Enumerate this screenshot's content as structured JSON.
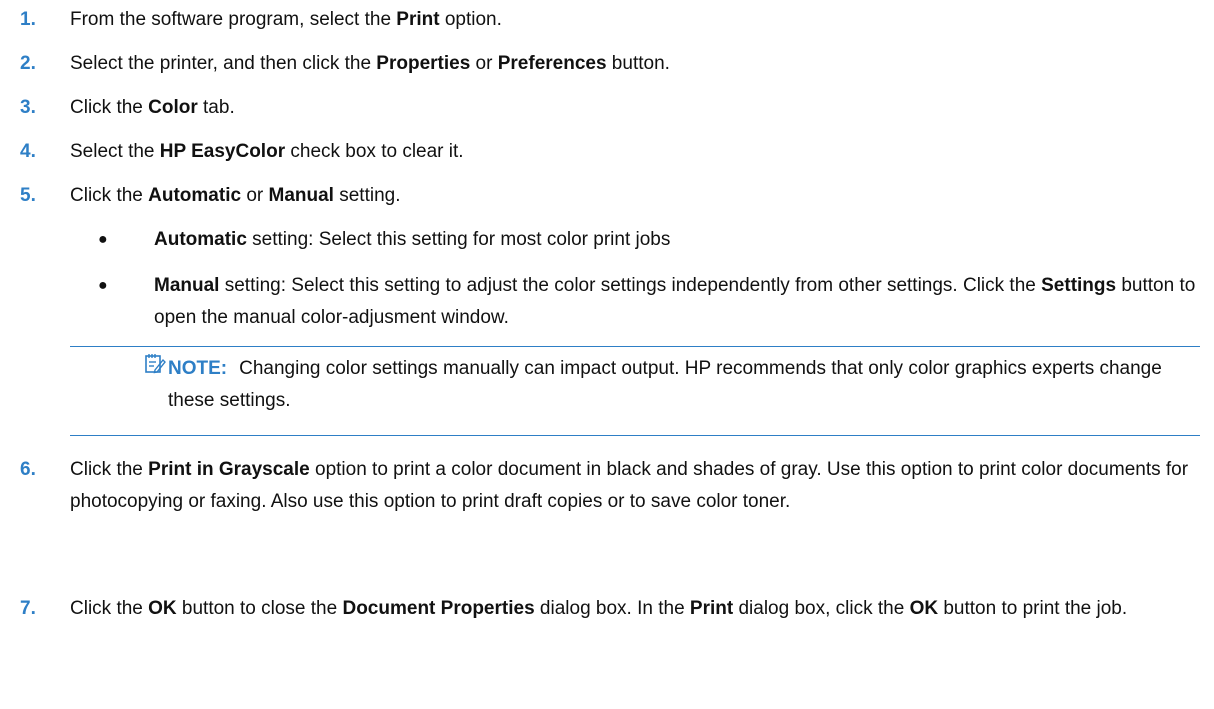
{
  "steps": [
    {
      "num": "1.",
      "parts": [
        "From the software program, select the ",
        "Print",
        " option."
      ]
    },
    {
      "num": "2.",
      "parts": [
        "Select the printer, and then click the ",
        "Properties",
        " or ",
        "Preferences",
        " button."
      ]
    },
    {
      "num": "3.",
      "parts": [
        "Click the ",
        "Color",
        " tab."
      ]
    },
    {
      "num": "4.",
      "parts": [
        "Select the ",
        "HP EasyColor",
        " check box to clear it."
      ]
    },
    {
      "num": "5.",
      "parts": [
        "Click the ",
        "Automatic",
        " or ",
        "Manual",
        " setting."
      ]
    },
    {
      "num": "6.",
      "parts": [
        "Click the ",
        "Print in Grayscale",
        " option to print a color document in black and shades of gray. Use this option to print color documents for photocopying or faxing. Also use this option to print draft copies or to save color toner."
      ]
    },
    {
      "num": "7.",
      "parts": [
        "Click the ",
        "OK",
        " button to close the ",
        "Document Properties",
        " dialog box. In the ",
        "Print",
        " dialog box, click the ",
        "OK",
        " button to print the job."
      ]
    }
  ],
  "bullets": [
    {
      "marker": "●",
      "parts": [
        "Automatic",
        " setting: Select this setting for most color print jobs"
      ]
    },
    {
      "marker": "●",
      "parts": [
        "Manual",
        " setting: Select this setting to adjust the color settings independently from other settings. Click the ",
        "Settings",
        " button to open the manual color-adjusment window."
      ]
    }
  ],
  "note": {
    "icon": "note-icon",
    "label": "NOTE:",
    "text": "Changing color settings manually can impact output. HP recommends that only color graphics experts change these settings."
  },
  "colors": {
    "accent": "#2e7fc6",
    "text": "#111111"
  }
}
